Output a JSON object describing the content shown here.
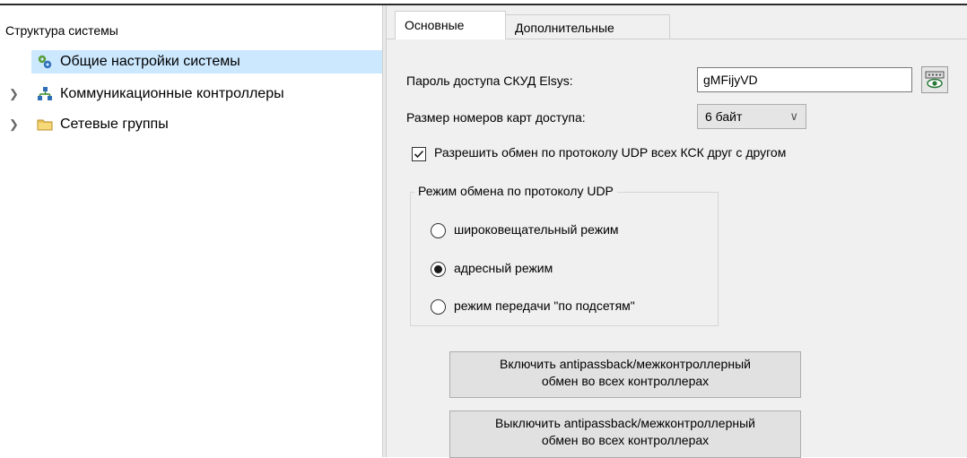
{
  "tree": {
    "title": "Структура системы",
    "items": [
      {
        "label": "Общие настройки системы",
        "icon": "gears-icon",
        "selected": true,
        "expandable": false
      },
      {
        "label": "Коммуникационные контроллеры",
        "icon": "network-icon",
        "selected": false,
        "expandable": true
      },
      {
        "label": "Сетевые группы",
        "icon": "folder-icon",
        "selected": false,
        "expandable": true
      }
    ]
  },
  "tabs": [
    {
      "label": "Основные",
      "active": true
    },
    {
      "label": "Дополнительные",
      "active": false
    }
  ],
  "form": {
    "password_label": "Пароль доступа СКУД Elsys:",
    "password_value": "gMFijyVD",
    "card_size_label": "Размер номеров карт доступа:",
    "card_size_value": "6 байт",
    "udp_checkbox_label": "Разрешить обмен по протоколу UDP всех КСК друг с другом",
    "udp_checkbox_checked": true,
    "udp_group_title": "Режим обмена по протоколу UDP",
    "udp_modes": [
      {
        "label": "широковещательный режим",
        "checked": false
      },
      {
        "label": "адресный режим",
        "checked": true
      },
      {
        "label": "режим передачи \"по подсетям\"",
        "checked": false
      }
    ],
    "enable_button": {
      "line1": "Включить antipassback/межконтроллерный",
      "line2": "обмен во всех контроллерах"
    },
    "disable_button": {
      "line1": "Выключить antipassback/межконтроллерный",
      "line2": "обмен во всех контроллерах"
    }
  },
  "colors": {
    "selection": "#cce8ff",
    "panel": "#f0f0f0",
    "button": "#e1e1e1"
  }
}
